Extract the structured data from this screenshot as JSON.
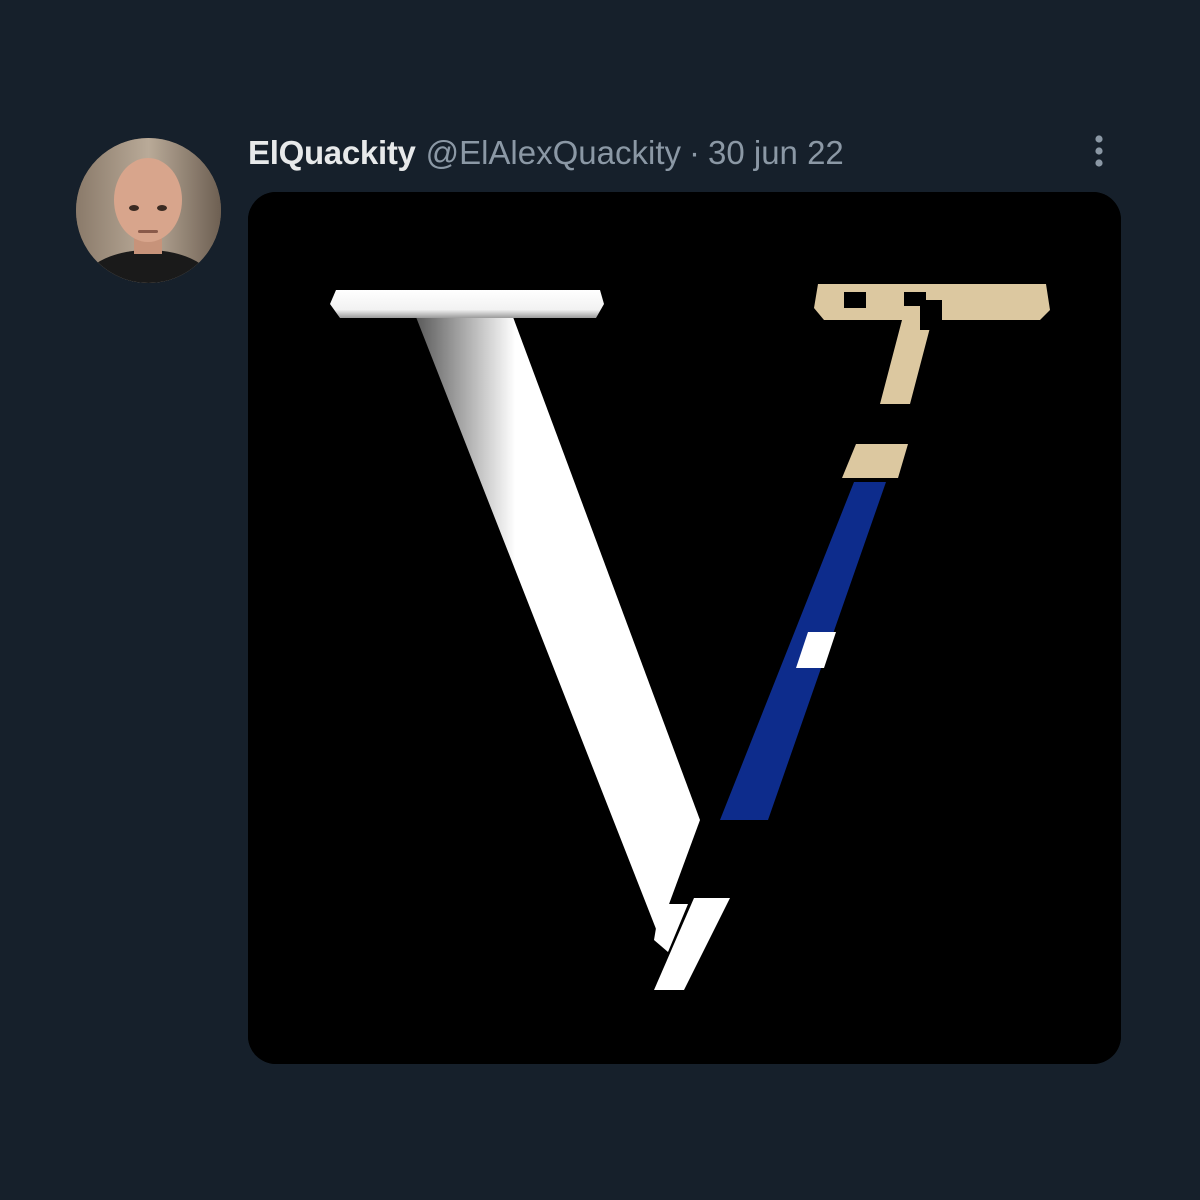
{
  "tweet": {
    "display_name": "ElQuackity",
    "handle": "@ElAlexQuackity",
    "separator": "·",
    "date": "30 jun 22"
  },
  "icons": {
    "more": "more-vertical-icon",
    "avatar": "user-avatar"
  },
  "colors": {
    "background": "#16202b",
    "name_text": "#e7e9ea",
    "secondary_text": "#8b98a5",
    "media_background": "#000000",
    "letter_white": "#ffffff",
    "letter_tan": "#dcc8a0",
    "letter_blue": "#0d2c8c"
  }
}
